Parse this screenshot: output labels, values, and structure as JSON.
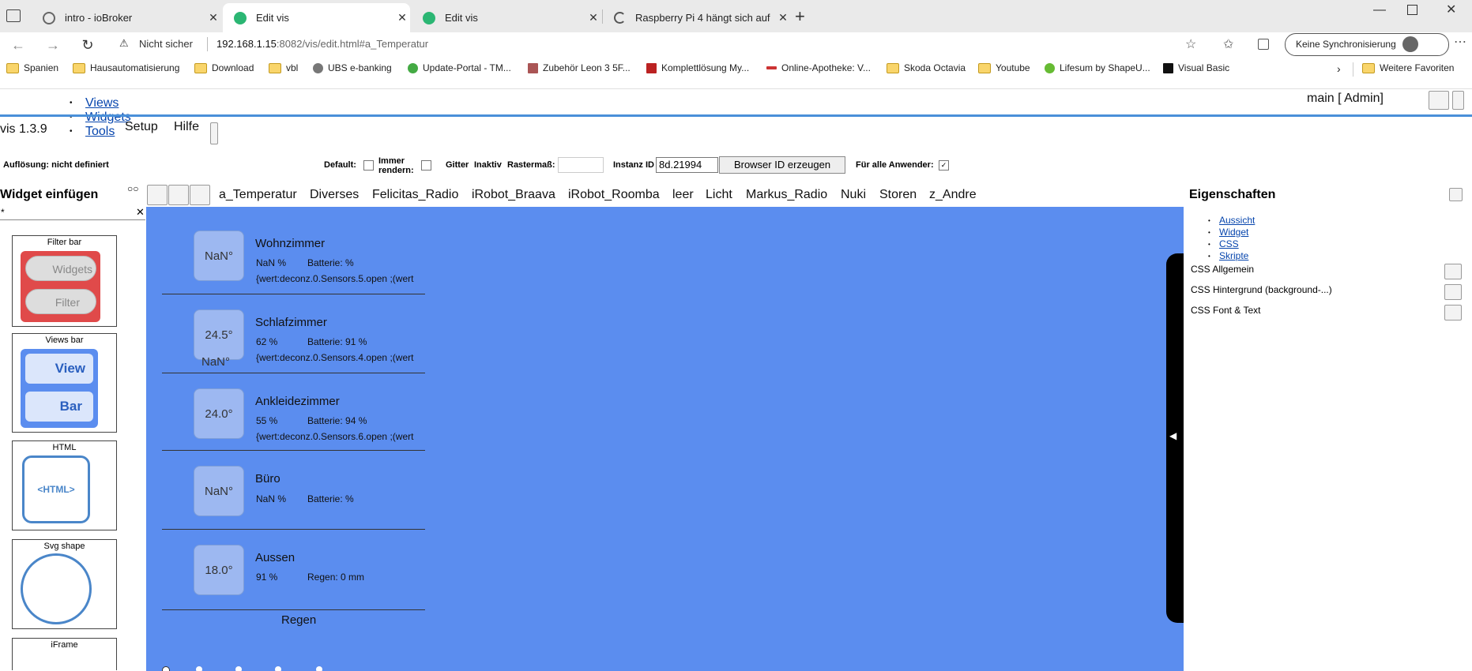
{
  "browser": {
    "tabs": [
      {
        "title": "intro - ioBroker",
        "active": false
      },
      {
        "title": "Edit vis",
        "active": true
      },
      {
        "title": "Edit vis",
        "active": false
      },
      {
        "title": "Raspberry Pi 4 hängt sich auf",
        "active": false
      }
    ],
    "address": {
      "security": "Nicht sicher",
      "url_host": "192.168.1.15",
      "url_rest": ":8082/vis/edit.html#a_Temperatur"
    },
    "sync_button": "Keine Synchronisierung",
    "bookmarks": [
      "Spanien",
      "Hausautomatisierung",
      "Download",
      "vbl",
      "UBS e-banking",
      "Update-Portal - TM...",
      "Zubehör Leon 3 5F...",
      "Komplettlösung My...",
      "Online-Apotheke: V...",
      "Skoda Octavia",
      "Youtube",
      "Lifesum by ShapeU...",
      "Visual Basic"
    ],
    "more_favorites": "Weitere Favoriten"
  },
  "editor": {
    "menu": {
      "views": "Views",
      "widgets": "Widgets",
      "tools": "Tools",
      "setup": "Setup",
      "hilfe": "Hilfe"
    },
    "version": "vis 1.3.9",
    "user": "main [ Admin]",
    "status": {
      "resolution": "Auflösung: nicht definiert",
      "default": "Default:",
      "always_render": "Immer rendern:",
      "grid": "Gitter",
      "inactive": "Inaktiv",
      "grid_size": "Rastermaß:",
      "instance_label": "Instanz ID",
      "instance_value": "8d.21994",
      "browser_id_button": "Browser ID erzeugen",
      "all_users": "Für alle Anwender:"
    },
    "widget_insert": "Widget einfügen",
    "filter_value": "*",
    "widgets": [
      {
        "caption": "Filter bar",
        "b1": "Widgets",
        "b2": "Filter"
      },
      {
        "caption": "Views bar",
        "b1": "View",
        "b2": "Bar"
      },
      {
        "caption": "HTML",
        "inner": "<HTML>"
      },
      {
        "caption": "Svg shape"
      },
      {
        "caption": "iFrame"
      }
    ],
    "view_tabs": [
      "a_Temperatur",
      "Diverses",
      "Felicitas_Radio",
      "iRobot_Braava",
      "iRobot_Roomba",
      "leer",
      "Licht",
      "Markus_Radio",
      "Nuki",
      "Storen",
      "z_Andre"
    ],
    "rooms": [
      {
        "temp": "NaN°",
        "name": "Wohnzimmer",
        "hum": "NaN %",
        "bat": "Batterie: %",
        "expr": "{wert:deconz.0.Sensors.5.open ;(wert"
      },
      {
        "temp": "24.5°",
        "name": "Schlafzimmer",
        "hum": "62 %",
        "bat": "Batterie: 91 %",
        "expr": "{wert:deconz.0.Sensors.4.open ;(wert",
        "extra": "NaN°"
      },
      {
        "temp": "24.0°",
        "name": "Ankleidezimmer",
        "hum": "55 %",
        "bat": "Batterie: 94 %",
        "expr": "{wert:deconz.0.Sensors.6.open ;(wert"
      },
      {
        "temp": "NaN°",
        "name": "Büro",
        "hum": "NaN %",
        "bat": "Batterie: %"
      },
      {
        "temp": "18.0°",
        "name": "Aussen",
        "hum": "91 %",
        "bat": "Regen: 0 mm"
      }
    ],
    "regen_label": "Regen",
    "properties": {
      "title": "Eigenschaften",
      "links": [
        "Aussicht",
        "Widget",
        "CSS",
        "Skripte"
      ],
      "sections": [
        "CSS Allgemein",
        "CSS Hintergrund (background-...)",
        "CSS Font & Text"
      ]
    }
  }
}
